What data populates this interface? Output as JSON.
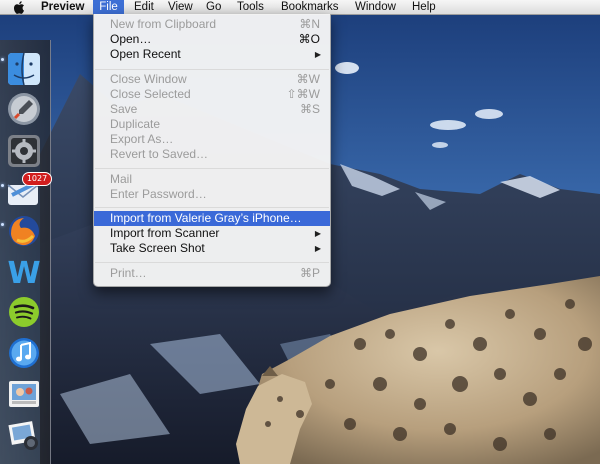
{
  "menubar": {
    "apple_glyph": "",
    "app_name": "Preview",
    "menus": [
      "File",
      "Edit",
      "View",
      "Go",
      "Tools",
      "Bookmarks",
      "Window",
      "Help"
    ],
    "active_menu": "File",
    "highlight_color": "#3d6fd5"
  },
  "file_menu": {
    "items": [
      {
        "label": "New from Clipboard",
        "shortcut": "⌘N",
        "enabled": false
      },
      {
        "label": "Open…",
        "shortcut": "⌘O",
        "enabled": true
      },
      {
        "label": "Open Recent",
        "shortcut": "",
        "enabled": true,
        "submenu": true
      },
      {
        "label": "Close Window",
        "shortcut": "⌘W",
        "enabled": false
      },
      {
        "label": "Close Selected",
        "shortcut": "⇧⌘W",
        "enabled": false
      },
      {
        "label": "Save",
        "shortcut": "⌘S",
        "enabled": false
      },
      {
        "label": "Duplicate",
        "shortcut": "",
        "enabled": false
      },
      {
        "label": "Export As…",
        "shortcut": "",
        "enabled": false
      },
      {
        "label": "Revert to Saved…",
        "shortcut": "",
        "enabled": false
      },
      {
        "label": "Mail",
        "shortcut": "",
        "enabled": false
      },
      {
        "label": "Enter Password…",
        "shortcut": "",
        "enabled": false
      },
      {
        "label": "Import from Valerie Gray’s iPhone…",
        "shortcut": "",
        "enabled": true,
        "highlighted": true
      },
      {
        "label": "Import from Scanner",
        "shortcut": "",
        "enabled": true,
        "submenu": true
      },
      {
        "label": "Take Screen Shot",
        "shortcut": "",
        "enabled": true,
        "submenu": true
      },
      {
        "label": "Print…",
        "shortcut": "⌘P",
        "enabled": false
      }
    ]
  },
  "dock": {
    "apps": [
      {
        "name": "finder-icon",
        "running": true
      },
      {
        "name": "launchpad-icon",
        "running": false
      },
      {
        "name": "system-preferences-icon",
        "running": false
      },
      {
        "name": "mail-icon",
        "running": true,
        "badge": "1027"
      },
      {
        "name": "firefox-icon",
        "running": true
      },
      {
        "name": "word-icon",
        "running": false
      },
      {
        "name": "spotify-icon",
        "running": false
      },
      {
        "name": "itunes-icon",
        "running": false
      },
      {
        "name": "photo-booth-icon",
        "running": false
      },
      {
        "name": "iphoto-icon",
        "running": false
      }
    ]
  }
}
